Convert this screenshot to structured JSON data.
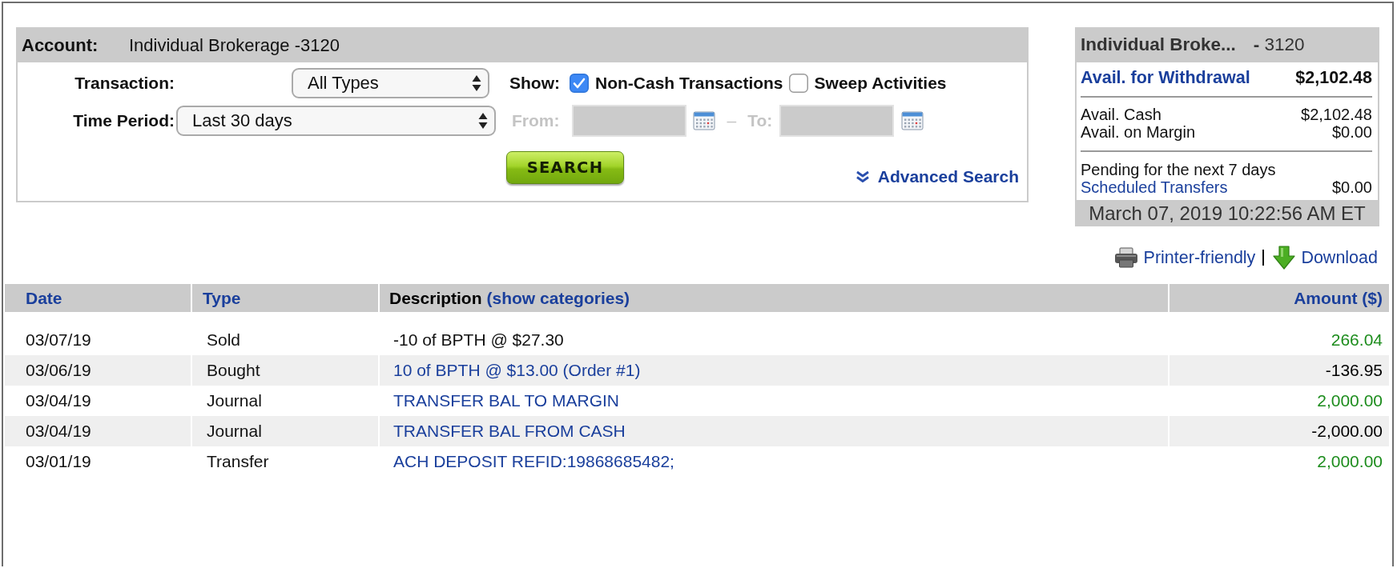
{
  "filters": {
    "account": {
      "label": "Account:",
      "value": "Individual Brokerage -3120"
    },
    "transaction": {
      "label": "Transaction:",
      "value": "All Types"
    },
    "show": {
      "label": "Show:",
      "options": [
        {
          "label": "Non-Cash Transactions",
          "checked": true
        },
        {
          "label": "Sweep Activities",
          "checked": false
        }
      ]
    },
    "time_period": {
      "label": "Time Period:",
      "value": "Last 30 days"
    },
    "date_range": {
      "disabled": true,
      "from_label": "From:",
      "separator": "–",
      "to_label": "To:"
    },
    "search_button": "SEARCH",
    "advanced_search": "Advanced Search"
  },
  "summary": {
    "title": "Individual Broke...",
    "number": "**-** 3120",
    "withdrawal": {
      "label": "Avail. for Withdrawal",
      "value": "$2,102.48"
    },
    "balances": [
      {
        "label": "Avail. Cash",
        "value": "$2,102.48"
      },
      {
        "label": "Avail. on Margin",
        "value": "$0.00"
      }
    ],
    "pending": {
      "label": "Pending for the next 7 days",
      "link": "Scheduled Transfers",
      "value": "$0.00"
    },
    "timestamp": "March 07, 2019 10:22:56 AM ET"
  },
  "links": [
    {
      "kind": "print",
      "label": "Printer-friendly"
    },
    {
      "kind": "download",
      "label": "Download"
    }
  ],
  "table": {
    "columns": [
      {
        "label": "Date",
        "sortable": true
      },
      {
        "label": "Type",
        "sortable": true
      },
      {
        "label": "Description",
        "sortable": false,
        "link": "(show categories)"
      },
      {
        "label": "Amount ($)",
        "sortable": true
      }
    ],
    "rows": [
      {
        "date": "03/07/19",
        "type": "Sold",
        "description": "-10 of BPTH @ $27.30",
        "description_link": false,
        "amount": "266.04",
        "color": "#1c8c1c"
      },
      {
        "date": "03/06/19",
        "type": "Bought",
        "description": "10 of BPTH @ $13.00 (Order #1)",
        "description_link": true,
        "amount": "-136.95",
        "color": "#000000"
      },
      {
        "date": "03/04/19",
        "type": "Journal",
        "description": "TRANSFER BAL TO MARGIN",
        "description_link": true,
        "amount": "2,000.00",
        "color": "#1c8c1c"
      },
      {
        "date": "03/04/19",
        "type": "Journal",
        "description": "TRANSFER BAL FROM CASH",
        "description_link": true,
        "amount": "-2,000.00",
        "color": "#000000"
      },
      {
        "date": "03/01/19",
        "type": "Transfer",
        "description": "ACH DEPOSIT REFID:19868685482;",
        "description_link": true,
        "amount": "2,000.00",
        "color": "#1c8c1c"
      }
    ]
  }
}
